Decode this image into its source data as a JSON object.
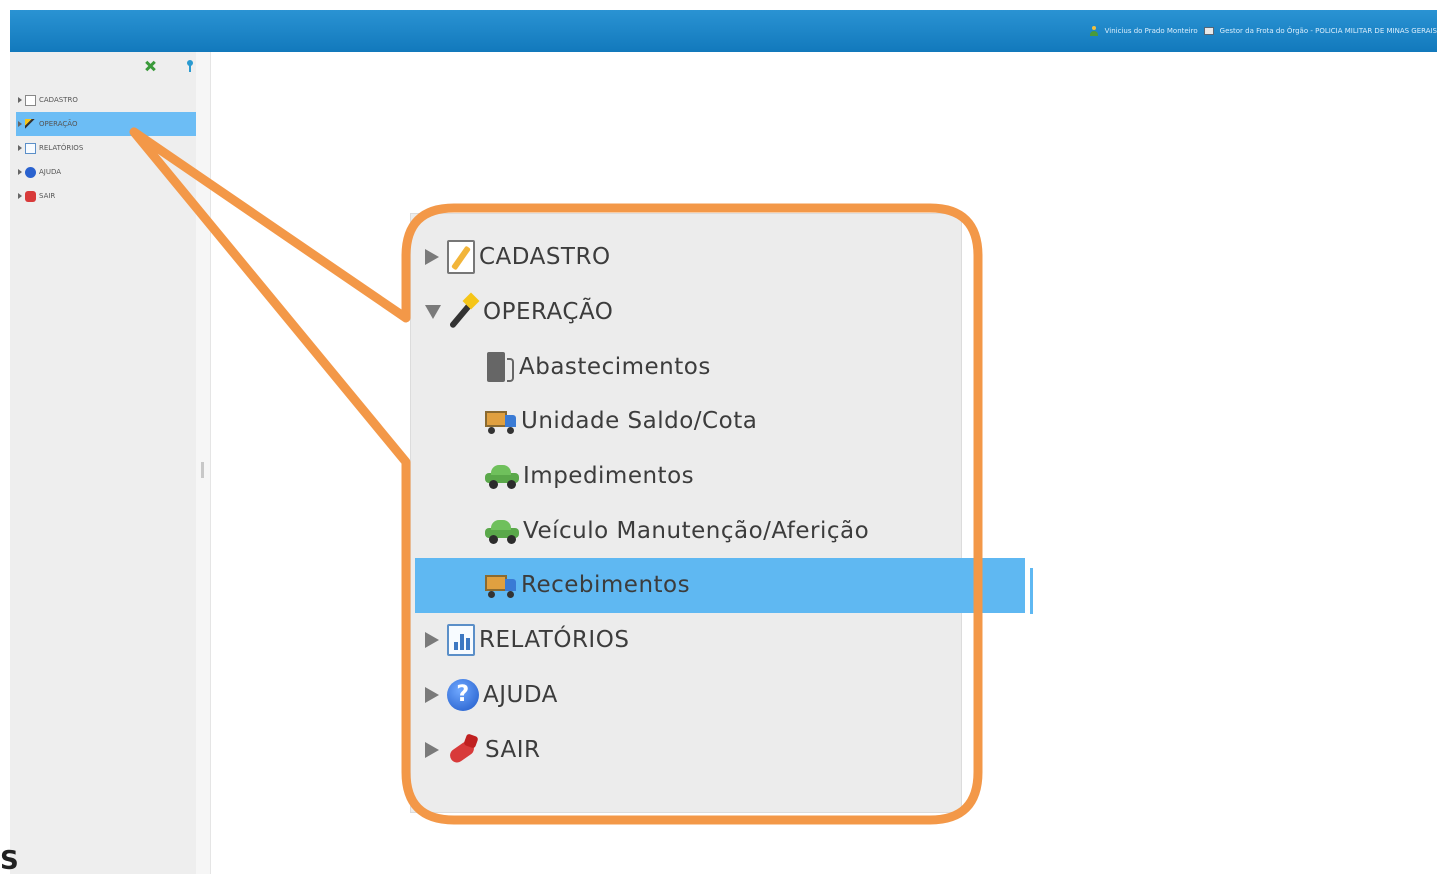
{
  "header": {
    "user_name": "Vinicius do Prado Monteiro",
    "profile": "Gestor da Frota do Órgão - POLICIA MILITAR DE MINAS GERAIS"
  },
  "sidebar": {
    "items": [
      {
        "label": "CADASTRO",
        "icon": "edit-document-icon"
      },
      {
        "label": "OPERAÇÃO",
        "icon": "magic-wand-icon",
        "selected": true
      },
      {
        "label": "RELATÓRIOS",
        "icon": "report-chart-icon"
      },
      {
        "label": "AJUDA",
        "icon": "help-icon"
      },
      {
        "label": "SAIR",
        "icon": "exit-icon"
      }
    ]
  },
  "menu": {
    "cadastro": "CADASTRO",
    "operacao": "OPERAÇÃO",
    "children": [
      {
        "label": "Abastecimentos",
        "icon": "fuel-pump-icon"
      },
      {
        "label": "Unidade Saldo/Cota",
        "icon": "truck-icon"
      },
      {
        "label": "Impedimentos",
        "icon": "car-icon"
      },
      {
        "label": "Veículo Manutenção/Aferição",
        "icon": "car-icon"
      },
      {
        "label": "Recebimentos",
        "icon": "truck-icon",
        "selected": true
      }
    ],
    "relatorios": "RELATÓRIOS",
    "ajuda": "AJUDA",
    "sair": "SAIR"
  },
  "colors": {
    "topbar": "#1a84c8",
    "selection": "#5fb8f2",
    "callout": "#f39848"
  },
  "footer_fragment": "S"
}
